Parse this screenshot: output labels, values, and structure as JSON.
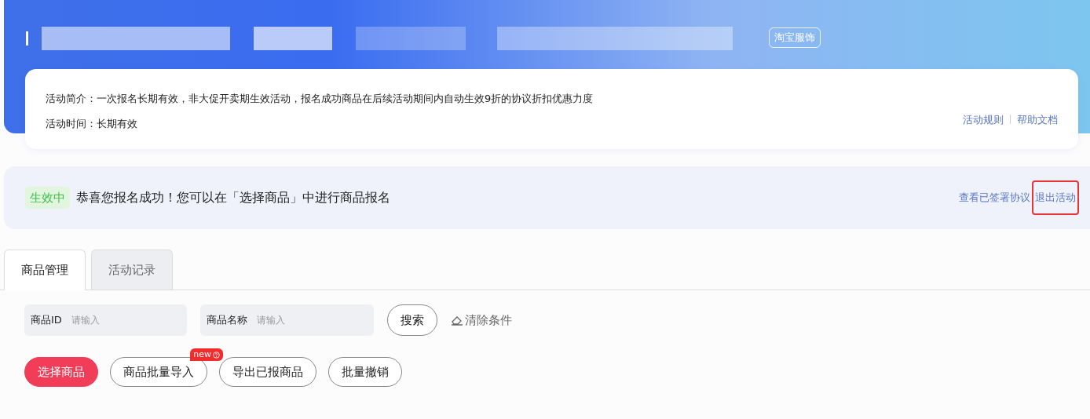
{
  "header": {
    "tag": "淘宝服饰"
  },
  "intro": {
    "summary_label": "活动简介：",
    "summary": "一次报名长期有效，非大促开卖期生效活动，报名成功商品在后续活动期间内自动生效9折的协议折扣优惠力度",
    "time_label": "活动时间：",
    "time": "长期有效",
    "links": [
      "活动规则",
      "帮助文档"
    ]
  },
  "status": {
    "badge": "生效中",
    "message": "恭喜您报名成功！您可以在「选择商品」中进行商品报名",
    "links": [
      {
        "label": "查看已签署协议",
        "highlighted": false
      },
      {
        "label": "退出活动",
        "highlighted": true
      }
    ]
  },
  "tabs": [
    {
      "label": "商品管理",
      "selected": true
    },
    {
      "label": "活动记录",
      "selected": false
    }
  ],
  "filters": [
    {
      "label": "商品ID",
      "placeholder": "请输入"
    },
    {
      "label": "商品名称",
      "placeholder": "请输入"
    }
  ],
  "search_button": "搜索",
  "clear_button": "清除条件",
  "actions": [
    {
      "label": "选择商品",
      "kind": "primary"
    },
    {
      "label": "商品批量导入",
      "kind": "outline",
      "badge": "new"
    },
    {
      "label": "导出已报商品",
      "kind": "outline"
    },
    {
      "label": "批量撤销",
      "kind": "outline"
    }
  ]
}
